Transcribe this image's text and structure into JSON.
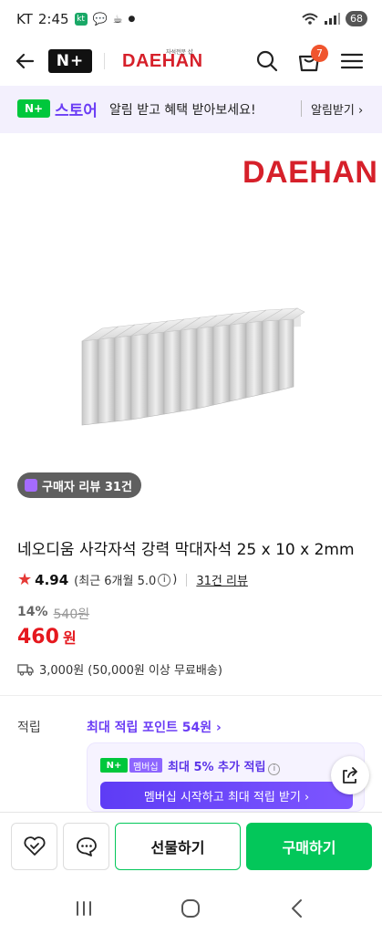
{
  "status_bar": {
    "carrier": "KT",
    "time": "2:45",
    "battery": "68"
  },
  "header": {
    "nplus_label": "N+",
    "brand": "DAEHAN",
    "brand_sub": "자석전문 샵",
    "cart_count": "7"
  },
  "promo": {
    "nplus_label": "N+",
    "store_label": "스토어",
    "message": "알림 받고 혜택 받아보세요!",
    "alarm_label": "알림받기 ›"
  },
  "product": {
    "brand_logo": "DAEHAN",
    "review_chip": "구매자 리뷰 31건",
    "title": "네오디움 사각자석 강력 막대자석 25 x 10 x 2mm",
    "rating": "4.94",
    "recent_rating": "(최근 6개월 5.0",
    "info_glyph": "i",
    "rating_close": ")",
    "review_link": "31건 리뷰",
    "discount_rate": "14%",
    "original_price": "540원",
    "price": "460",
    "price_unit": "원",
    "shipping": "3,000원 (50,000원 이상 무료배송)"
  },
  "points": {
    "label": "적립",
    "value": "최대 적립 포인트 54원 ›",
    "nplus_label": "N+",
    "member_tag": "멤버십",
    "member_text": "최대 5% 추가 적립",
    "member_right": "1",
    "cta": "멤버십 시작하고 최대 적립 받기 ›"
  },
  "bottom_bar": {
    "gift_label": "선물하기",
    "buy_label": "구매하기"
  },
  "colors": {
    "brand_red": "#d6202a",
    "naver_green": "#03c75a",
    "accent_purple": "#6b3df5",
    "price_red": "#e5181e"
  }
}
